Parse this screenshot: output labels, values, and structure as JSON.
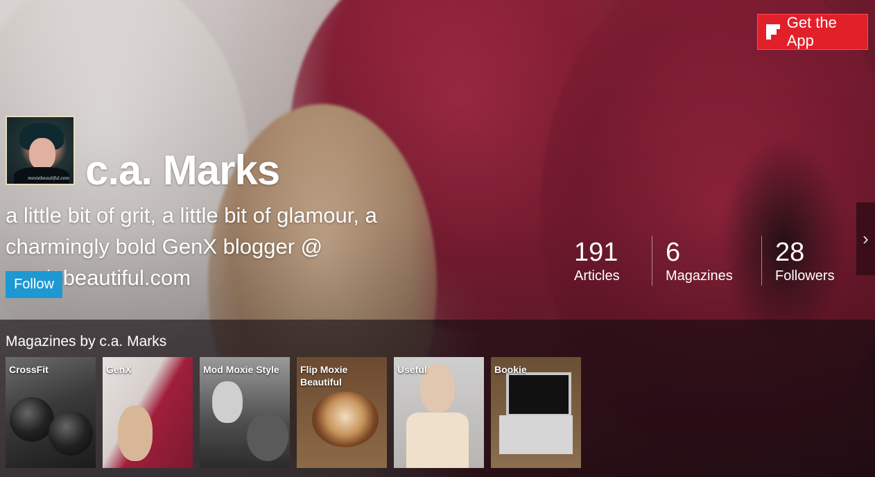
{
  "header": {
    "get_app_label": "Get the App"
  },
  "profile": {
    "name": "c.a. Marks",
    "bio": "a little bit of grit, a little bit of glamour, a charmingly bold GenX blogger @ moxiebeautiful.com",
    "follow_label": "Follow",
    "avatar_signature": "moxiebeautiful.com"
  },
  "stats": [
    {
      "value": "191",
      "label": "Articles"
    },
    {
      "value": "6",
      "label": "Magazines"
    },
    {
      "value": "28",
      "label": "Followers"
    }
  ],
  "magazines": {
    "title": "Magazines by c.a. Marks",
    "items": [
      {
        "label": "CrossFit"
      },
      {
        "label": "GenX"
      },
      {
        "label": "Mod Moxie Style"
      },
      {
        "label": "Flip Moxie Beautiful"
      },
      {
        "label": "Useful"
      },
      {
        "label": "Bookie"
      }
    ]
  },
  "colors": {
    "accent_red": "#e1202a",
    "follow_blue": "#1e98d3"
  },
  "icons": {
    "app_icon": "flipboard-icon",
    "next": "chevron-right-icon"
  }
}
